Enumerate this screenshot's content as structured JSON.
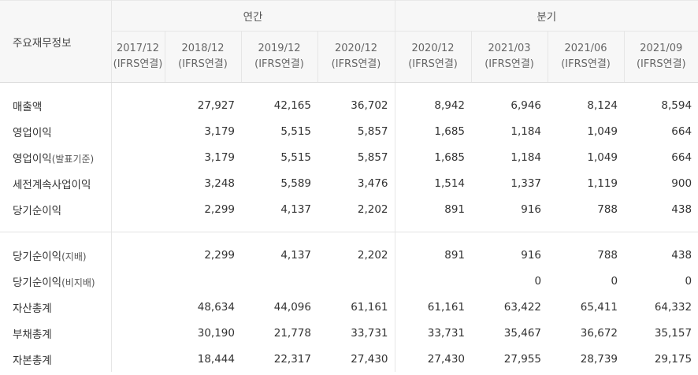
{
  "table": {
    "corner_label": "주요재무정보",
    "groups": {
      "annual": "연간",
      "quarterly": "분기"
    },
    "periods": [
      {
        "date": "2017/12",
        "type": "(IFRS연결)"
      },
      {
        "date": "2018/12",
        "type": "(IFRS연결)"
      },
      {
        "date": "2019/12",
        "type": "(IFRS연결)"
      },
      {
        "date": "2020/12",
        "type": "(IFRS연결)"
      },
      {
        "date": "2020/12",
        "type": "(IFRS연결)"
      },
      {
        "date": "2021/03",
        "type": "(IFRS연결)"
      },
      {
        "date": "2021/06",
        "type": "(IFRS연결)"
      },
      {
        "date": "2021/09",
        "type": "(IFRS연결)"
      }
    ],
    "rows": [
      {
        "label": "매출액",
        "suffix": "",
        "values": [
          "",
          "27,927",
          "42,165",
          "36,702",
          "8,942",
          "6,946",
          "8,124",
          "8,594"
        ]
      },
      {
        "label": "영업이익",
        "suffix": "",
        "values": [
          "",
          "3,179",
          "5,515",
          "5,857",
          "1,685",
          "1,184",
          "1,049",
          "664"
        ]
      },
      {
        "label": "영업이익",
        "suffix": "(발표기준)",
        "values": [
          "",
          "3,179",
          "5,515",
          "5,857",
          "1,685",
          "1,184",
          "1,049",
          "664"
        ]
      },
      {
        "label": "세전계속사업이익",
        "suffix": "",
        "values": [
          "",
          "3,248",
          "5,589",
          "3,476",
          "1,514",
          "1,337",
          "1,119",
          "900"
        ]
      },
      {
        "label": "당기순이익",
        "suffix": "",
        "values": [
          "",
          "2,299",
          "4,137",
          "2,202",
          "891",
          "916",
          "788",
          "438"
        ]
      },
      {
        "label": "당기순이익",
        "suffix": "(지배)",
        "values": [
          "",
          "2,299",
          "4,137",
          "2,202",
          "891",
          "916",
          "788",
          "438"
        ]
      },
      {
        "label": "당기순이익",
        "suffix": "(비지배)",
        "values": [
          "",
          "",
          "",
          "",
          "",
          "0",
          "0",
          "0"
        ]
      },
      {
        "label": "자산총계",
        "suffix": "",
        "values": [
          "",
          "48,634",
          "44,096",
          "61,161",
          "61,161",
          "63,422",
          "65,411",
          "64,332"
        ]
      },
      {
        "label": "부채총계",
        "suffix": "",
        "values": [
          "",
          "30,190",
          "21,778",
          "33,731",
          "33,731",
          "35,467",
          "36,672",
          "35,157"
        ]
      },
      {
        "label": "자본총계",
        "suffix": "",
        "values": [
          "",
          "18,444",
          "22,317",
          "27,430",
          "27,430",
          "27,955",
          "28,739",
          "29,175"
        ]
      }
    ]
  }
}
